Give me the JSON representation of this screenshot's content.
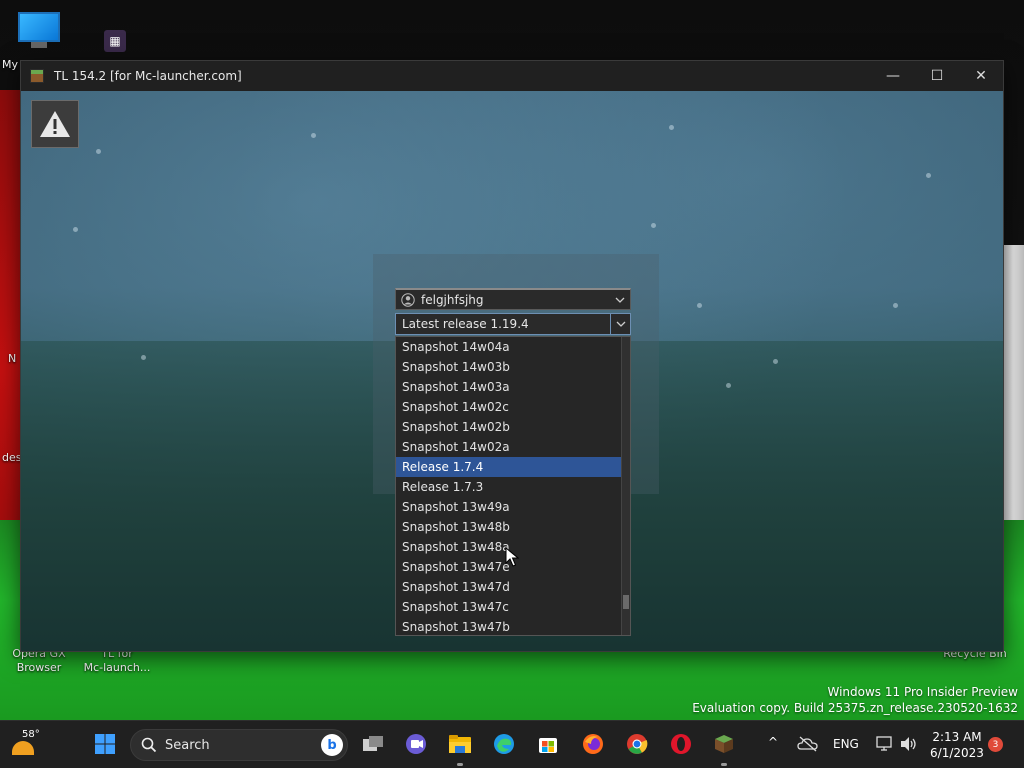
{
  "window": {
    "title": "TL 154.2 [for Mc-launcher.com]",
    "minimize_glyph": "—",
    "maximize_glyph": "☐",
    "close_glyph": "✕"
  },
  "desktop": {
    "labels": [
      "My",
      "Opera GX\nBrowser",
      "TL for\nMc-launch...",
      "Recycle Bin",
      "N",
      "des"
    ],
    "watermark_line1": "Windows 11 Pro Insider Preview",
    "watermark_line2": "Evaluation copy. Build 25375.zn_release.230520-1632"
  },
  "launcher": {
    "warning_icon": "warning-icon",
    "account": {
      "name": "felgjhfsjhg"
    },
    "version": {
      "selected": "Latest release 1.19.4"
    },
    "version_list": [
      "Snapshot 14w04a",
      "Snapshot 14w03b",
      "Snapshot 14w03a",
      "Snapshot 14w02c",
      "Snapshot 14w02b",
      "Snapshot 14w02a",
      "Release 1.7.4",
      "Release 1.7.3",
      "Snapshot 13w49a",
      "Snapshot 13w48b",
      "Snapshot 13w48a",
      "Snapshot 13w47e",
      "Snapshot 13w47d",
      "Snapshot 13w47c",
      "Snapshot 13w47b"
    ],
    "highlighted_index": 6
  },
  "taskbar": {
    "weather_temp": "58°",
    "search_label": "Search",
    "bing_label": "b",
    "lang": "ENG",
    "time": "2:13 AM",
    "date": "6/1/2023",
    "notifications": "3",
    "tray_chevron": "^"
  },
  "colors": {
    "selection": "#2e5597",
    "taskbar": "#202020"
  }
}
